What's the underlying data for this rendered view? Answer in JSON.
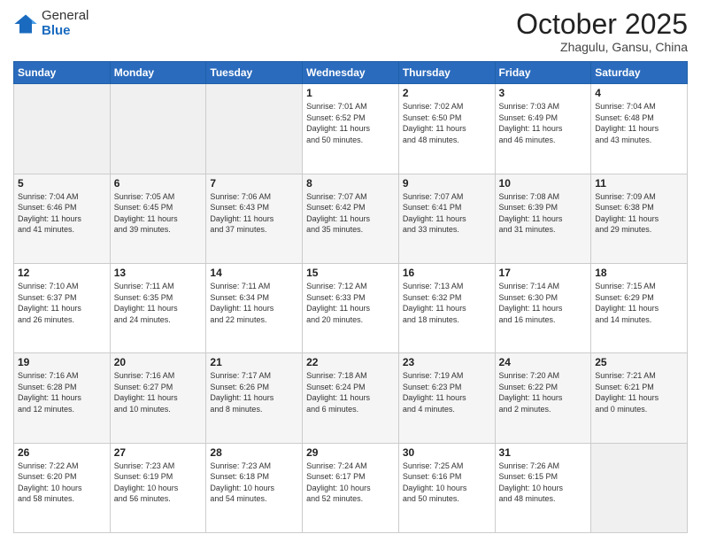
{
  "logo": {
    "general": "General",
    "blue": "Blue"
  },
  "header": {
    "month": "October 2025",
    "location": "Zhagulu, Gansu, China"
  },
  "days_of_week": [
    "Sunday",
    "Monday",
    "Tuesday",
    "Wednesday",
    "Thursday",
    "Friday",
    "Saturday"
  ],
  "weeks": [
    [
      {
        "day": "",
        "info": ""
      },
      {
        "day": "",
        "info": ""
      },
      {
        "day": "",
        "info": ""
      },
      {
        "day": "1",
        "info": "Sunrise: 7:01 AM\nSunset: 6:52 PM\nDaylight: 11 hours\nand 50 minutes."
      },
      {
        "day": "2",
        "info": "Sunrise: 7:02 AM\nSunset: 6:50 PM\nDaylight: 11 hours\nand 48 minutes."
      },
      {
        "day": "3",
        "info": "Sunrise: 7:03 AM\nSunset: 6:49 PM\nDaylight: 11 hours\nand 46 minutes."
      },
      {
        "day": "4",
        "info": "Sunrise: 7:04 AM\nSunset: 6:48 PM\nDaylight: 11 hours\nand 43 minutes."
      }
    ],
    [
      {
        "day": "5",
        "info": "Sunrise: 7:04 AM\nSunset: 6:46 PM\nDaylight: 11 hours\nand 41 minutes."
      },
      {
        "day": "6",
        "info": "Sunrise: 7:05 AM\nSunset: 6:45 PM\nDaylight: 11 hours\nand 39 minutes."
      },
      {
        "day": "7",
        "info": "Sunrise: 7:06 AM\nSunset: 6:43 PM\nDaylight: 11 hours\nand 37 minutes."
      },
      {
        "day": "8",
        "info": "Sunrise: 7:07 AM\nSunset: 6:42 PM\nDaylight: 11 hours\nand 35 minutes."
      },
      {
        "day": "9",
        "info": "Sunrise: 7:07 AM\nSunset: 6:41 PM\nDaylight: 11 hours\nand 33 minutes."
      },
      {
        "day": "10",
        "info": "Sunrise: 7:08 AM\nSunset: 6:39 PM\nDaylight: 11 hours\nand 31 minutes."
      },
      {
        "day": "11",
        "info": "Sunrise: 7:09 AM\nSunset: 6:38 PM\nDaylight: 11 hours\nand 29 minutes."
      }
    ],
    [
      {
        "day": "12",
        "info": "Sunrise: 7:10 AM\nSunset: 6:37 PM\nDaylight: 11 hours\nand 26 minutes."
      },
      {
        "day": "13",
        "info": "Sunrise: 7:11 AM\nSunset: 6:35 PM\nDaylight: 11 hours\nand 24 minutes."
      },
      {
        "day": "14",
        "info": "Sunrise: 7:11 AM\nSunset: 6:34 PM\nDaylight: 11 hours\nand 22 minutes."
      },
      {
        "day": "15",
        "info": "Sunrise: 7:12 AM\nSunset: 6:33 PM\nDaylight: 11 hours\nand 20 minutes."
      },
      {
        "day": "16",
        "info": "Sunrise: 7:13 AM\nSunset: 6:32 PM\nDaylight: 11 hours\nand 18 minutes."
      },
      {
        "day": "17",
        "info": "Sunrise: 7:14 AM\nSunset: 6:30 PM\nDaylight: 11 hours\nand 16 minutes."
      },
      {
        "day": "18",
        "info": "Sunrise: 7:15 AM\nSunset: 6:29 PM\nDaylight: 11 hours\nand 14 minutes."
      }
    ],
    [
      {
        "day": "19",
        "info": "Sunrise: 7:16 AM\nSunset: 6:28 PM\nDaylight: 11 hours\nand 12 minutes."
      },
      {
        "day": "20",
        "info": "Sunrise: 7:16 AM\nSunset: 6:27 PM\nDaylight: 11 hours\nand 10 minutes."
      },
      {
        "day": "21",
        "info": "Sunrise: 7:17 AM\nSunset: 6:26 PM\nDaylight: 11 hours\nand 8 minutes."
      },
      {
        "day": "22",
        "info": "Sunrise: 7:18 AM\nSunset: 6:24 PM\nDaylight: 11 hours\nand 6 minutes."
      },
      {
        "day": "23",
        "info": "Sunrise: 7:19 AM\nSunset: 6:23 PM\nDaylight: 11 hours\nand 4 minutes."
      },
      {
        "day": "24",
        "info": "Sunrise: 7:20 AM\nSunset: 6:22 PM\nDaylight: 11 hours\nand 2 minutes."
      },
      {
        "day": "25",
        "info": "Sunrise: 7:21 AM\nSunset: 6:21 PM\nDaylight: 11 hours\nand 0 minutes."
      }
    ],
    [
      {
        "day": "26",
        "info": "Sunrise: 7:22 AM\nSunset: 6:20 PM\nDaylight: 10 hours\nand 58 minutes."
      },
      {
        "day": "27",
        "info": "Sunrise: 7:23 AM\nSunset: 6:19 PM\nDaylight: 10 hours\nand 56 minutes."
      },
      {
        "day": "28",
        "info": "Sunrise: 7:23 AM\nSunset: 6:18 PM\nDaylight: 10 hours\nand 54 minutes."
      },
      {
        "day": "29",
        "info": "Sunrise: 7:24 AM\nSunset: 6:17 PM\nDaylight: 10 hours\nand 52 minutes."
      },
      {
        "day": "30",
        "info": "Sunrise: 7:25 AM\nSunset: 6:16 PM\nDaylight: 10 hours\nand 50 minutes."
      },
      {
        "day": "31",
        "info": "Sunrise: 7:26 AM\nSunset: 6:15 PM\nDaylight: 10 hours\nand 48 minutes."
      },
      {
        "day": "",
        "info": ""
      }
    ]
  ]
}
